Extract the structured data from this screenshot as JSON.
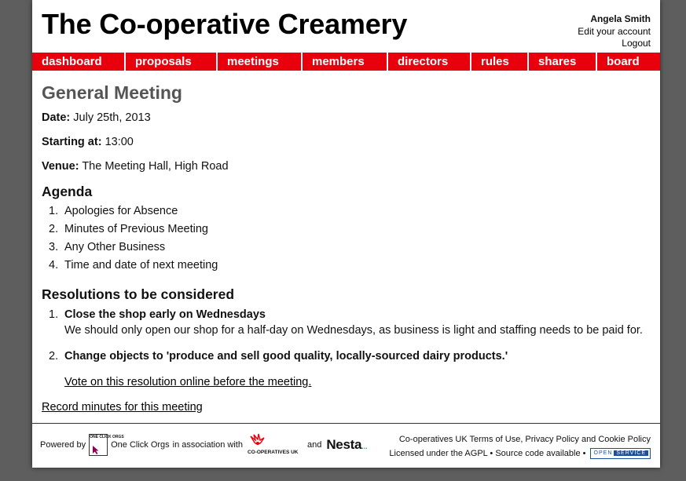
{
  "header": {
    "site_title": "The Co-operative Creamery",
    "user_name": "Angela Smith",
    "edit_account": "Edit your account",
    "logout": "Logout"
  },
  "nav": {
    "items": [
      {
        "label": "dashboard"
      },
      {
        "label": "proposals"
      },
      {
        "label": "meetings"
      },
      {
        "label": "members"
      },
      {
        "label": "directors"
      },
      {
        "label": "rules"
      },
      {
        "label": "shares"
      },
      {
        "label": "board"
      }
    ],
    "color": "#e8000c"
  },
  "meeting": {
    "title": "General Meeting",
    "date_label": "Date:",
    "date_value": "July 25th, 2013",
    "start_label": "Starting at:",
    "start_value": "13:00",
    "venue_label": "Venue:",
    "venue_value": "The Meeting Hall, High Road"
  },
  "agenda": {
    "heading": "Agenda",
    "items": [
      {
        "num": "1.",
        "text": "Apologies for Absence"
      },
      {
        "num": "2.",
        "text": "Minutes of Previous Meeting"
      },
      {
        "num": "3.",
        "text": "Any Other Business"
      },
      {
        "num": "4.",
        "text": "Time and date of next meeting"
      }
    ]
  },
  "resolutions": {
    "heading": "Resolutions to be considered",
    "items": [
      {
        "num": "1.",
        "title": "Close the shop early on Wednesdays",
        "body": "We should only open our shop for a half-day on Wednesdays, as business is light and staffing needs to be paid for."
      },
      {
        "num": "2.",
        "title": "Change objects to 'produce and sell good quality, locally-sourced dairy products.'",
        "vote_link": "Vote on this resolution online before the meeting."
      }
    ],
    "record_link": "Record minutes for this meeting"
  },
  "footer": {
    "powered_by": "Powered by",
    "oco_logo_text": "ONE CLICK ORGS",
    "oco_name": "One Click Orgs",
    "association": "in association with",
    "coop_logo_text": "CO-OPERATIVES UK",
    "and": "and",
    "nesta": "Nesta",
    "nesta_dots": "...",
    "terms_line": "Co-operatives UK Terms of Use, Privacy Policy and Cookie Policy",
    "license_text": "Licensed under the AGPL • Source code available •",
    "open_service_1": "OPEN",
    "open_service_2": "SERVICE"
  }
}
